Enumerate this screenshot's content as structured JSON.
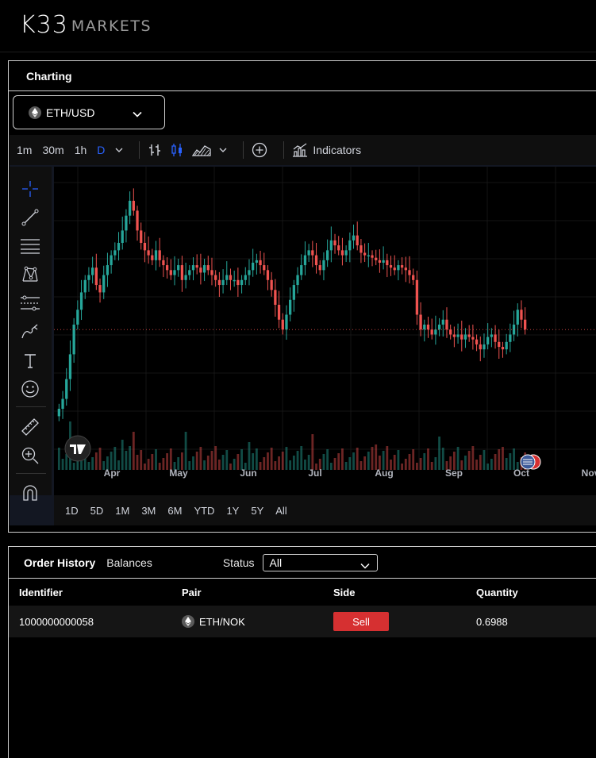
{
  "brand": {
    "logo_main": "K33",
    "logo_sub": "MARKETS"
  },
  "charting": {
    "title": "Charting",
    "pair": "ETH/USD",
    "timeframes": [
      "1m",
      "30m",
      "1h",
      "D"
    ],
    "active_timeframe": "D",
    "indicators_label": "Indicators",
    "x_labels": [
      "Apr",
      "May",
      "Jun",
      "Jul",
      "Aug",
      "Sep",
      "Oct",
      "Nov"
    ],
    "ranges": [
      "1D",
      "5D",
      "1M",
      "3M",
      "6M",
      "YTD",
      "1Y",
      "5Y",
      "All"
    ],
    "side_tools": [
      "crosshair-icon",
      "trend-line-icon",
      "fib-retracement-icon",
      "pattern-icon",
      "projection-icon",
      "brush-icon",
      "text-icon",
      "emoji-icon",
      "ruler-icon",
      "zoom-in-icon",
      "magnet-icon"
    ],
    "colors": {
      "up": "#26a69a",
      "down": "#ef5350",
      "accent": "#2962ff"
    }
  },
  "orders": {
    "tabs": [
      "Order History",
      "Balances"
    ],
    "status_label": "Status",
    "status_value": "All",
    "columns": [
      "Identifier",
      "Pair",
      "Side",
      "Quantity"
    ],
    "rows": [
      {
        "identifier": "1000000000058",
        "pair": "ETH/NOK",
        "side": "Sell",
        "quantity": "0.6988"
      }
    ]
  },
  "chart_data": {
    "type": "candlestick",
    "title": "",
    "x_labels": [
      "Apr",
      "May",
      "Jun",
      "Jul",
      "Aug",
      "Sep",
      "Oct",
      "Nov"
    ],
    "series": [
      {
        "values": [
          0.08,
          0.12,
          0.2,
          0.3,
          0.42,
          0.48,
          0.55,
          0.6,
          0.62,
          0.65,
          0.58,
          0.55,
          0.62,
          0.66,
          0.7,
          0.72,
          0.75,
          0.8,
          0.86,
          0.92,
          0.88,
          0.8,
          0.75,
          0.72,
          0.7,
          0.68,
          0.72,
          0.68,
          0.66,
          0.64,
          0.62,
          0.64,
          0.66,
          0.6,
          0.62,
          0.64,
          0.66,
          0.65,
          0.63,
          0.66,
          0.64,
          0.62,
          0.6,
          0.58,
          0.6,
          0.62,
          0.6,
          0.6,
          0.58,
          0.6,
          0.62,
          0.64,
          0.67,
          0.68,
          0.66,
          0.64,
          0.6,
          0.56,
          0.5,
          0.44,
          0.4,
          0.46,
          0.52,
          0.58,
          0.62,
          0.66,
          0.7,
          0.72,
          0.7,
          0.66,
          0.64,
          0.68,
          0.72,
          0.76,
          0.74,
          0.72,
          0.7,
          0.72,
          0.76,
          0.78,
          0.74,
          0.71,
          0.7,
          0.7,
          0.69,
          0.68,
          0.67,
          0.68,
          0.66,
          0.65,
          0.64,
          0.66,
          0.65,
          0.64,
          0.62,
          0.6,
          0.46,
          0.4,
          0.42,
          0.4,
          0.38,
          0.4,
          0.42,
          0.44,
          0.4,
          0.38,
          0.37,
          0.38,
          0.36,
          0.38,
          0.37,
          0.36,
          0.34,
          0.32,
          0.34,
          0.37,
          0.38,
          0.35,
          0.33,
          0.32,
          0.35,
          0.38,
          0.42,
          0.48,
          0.44,
          0.4
        ]
      }
    ],
    "up_color": "#26a69a",
    "down_color": "#ef5350",
    "grid": true,
    "volume": true
  }
}
